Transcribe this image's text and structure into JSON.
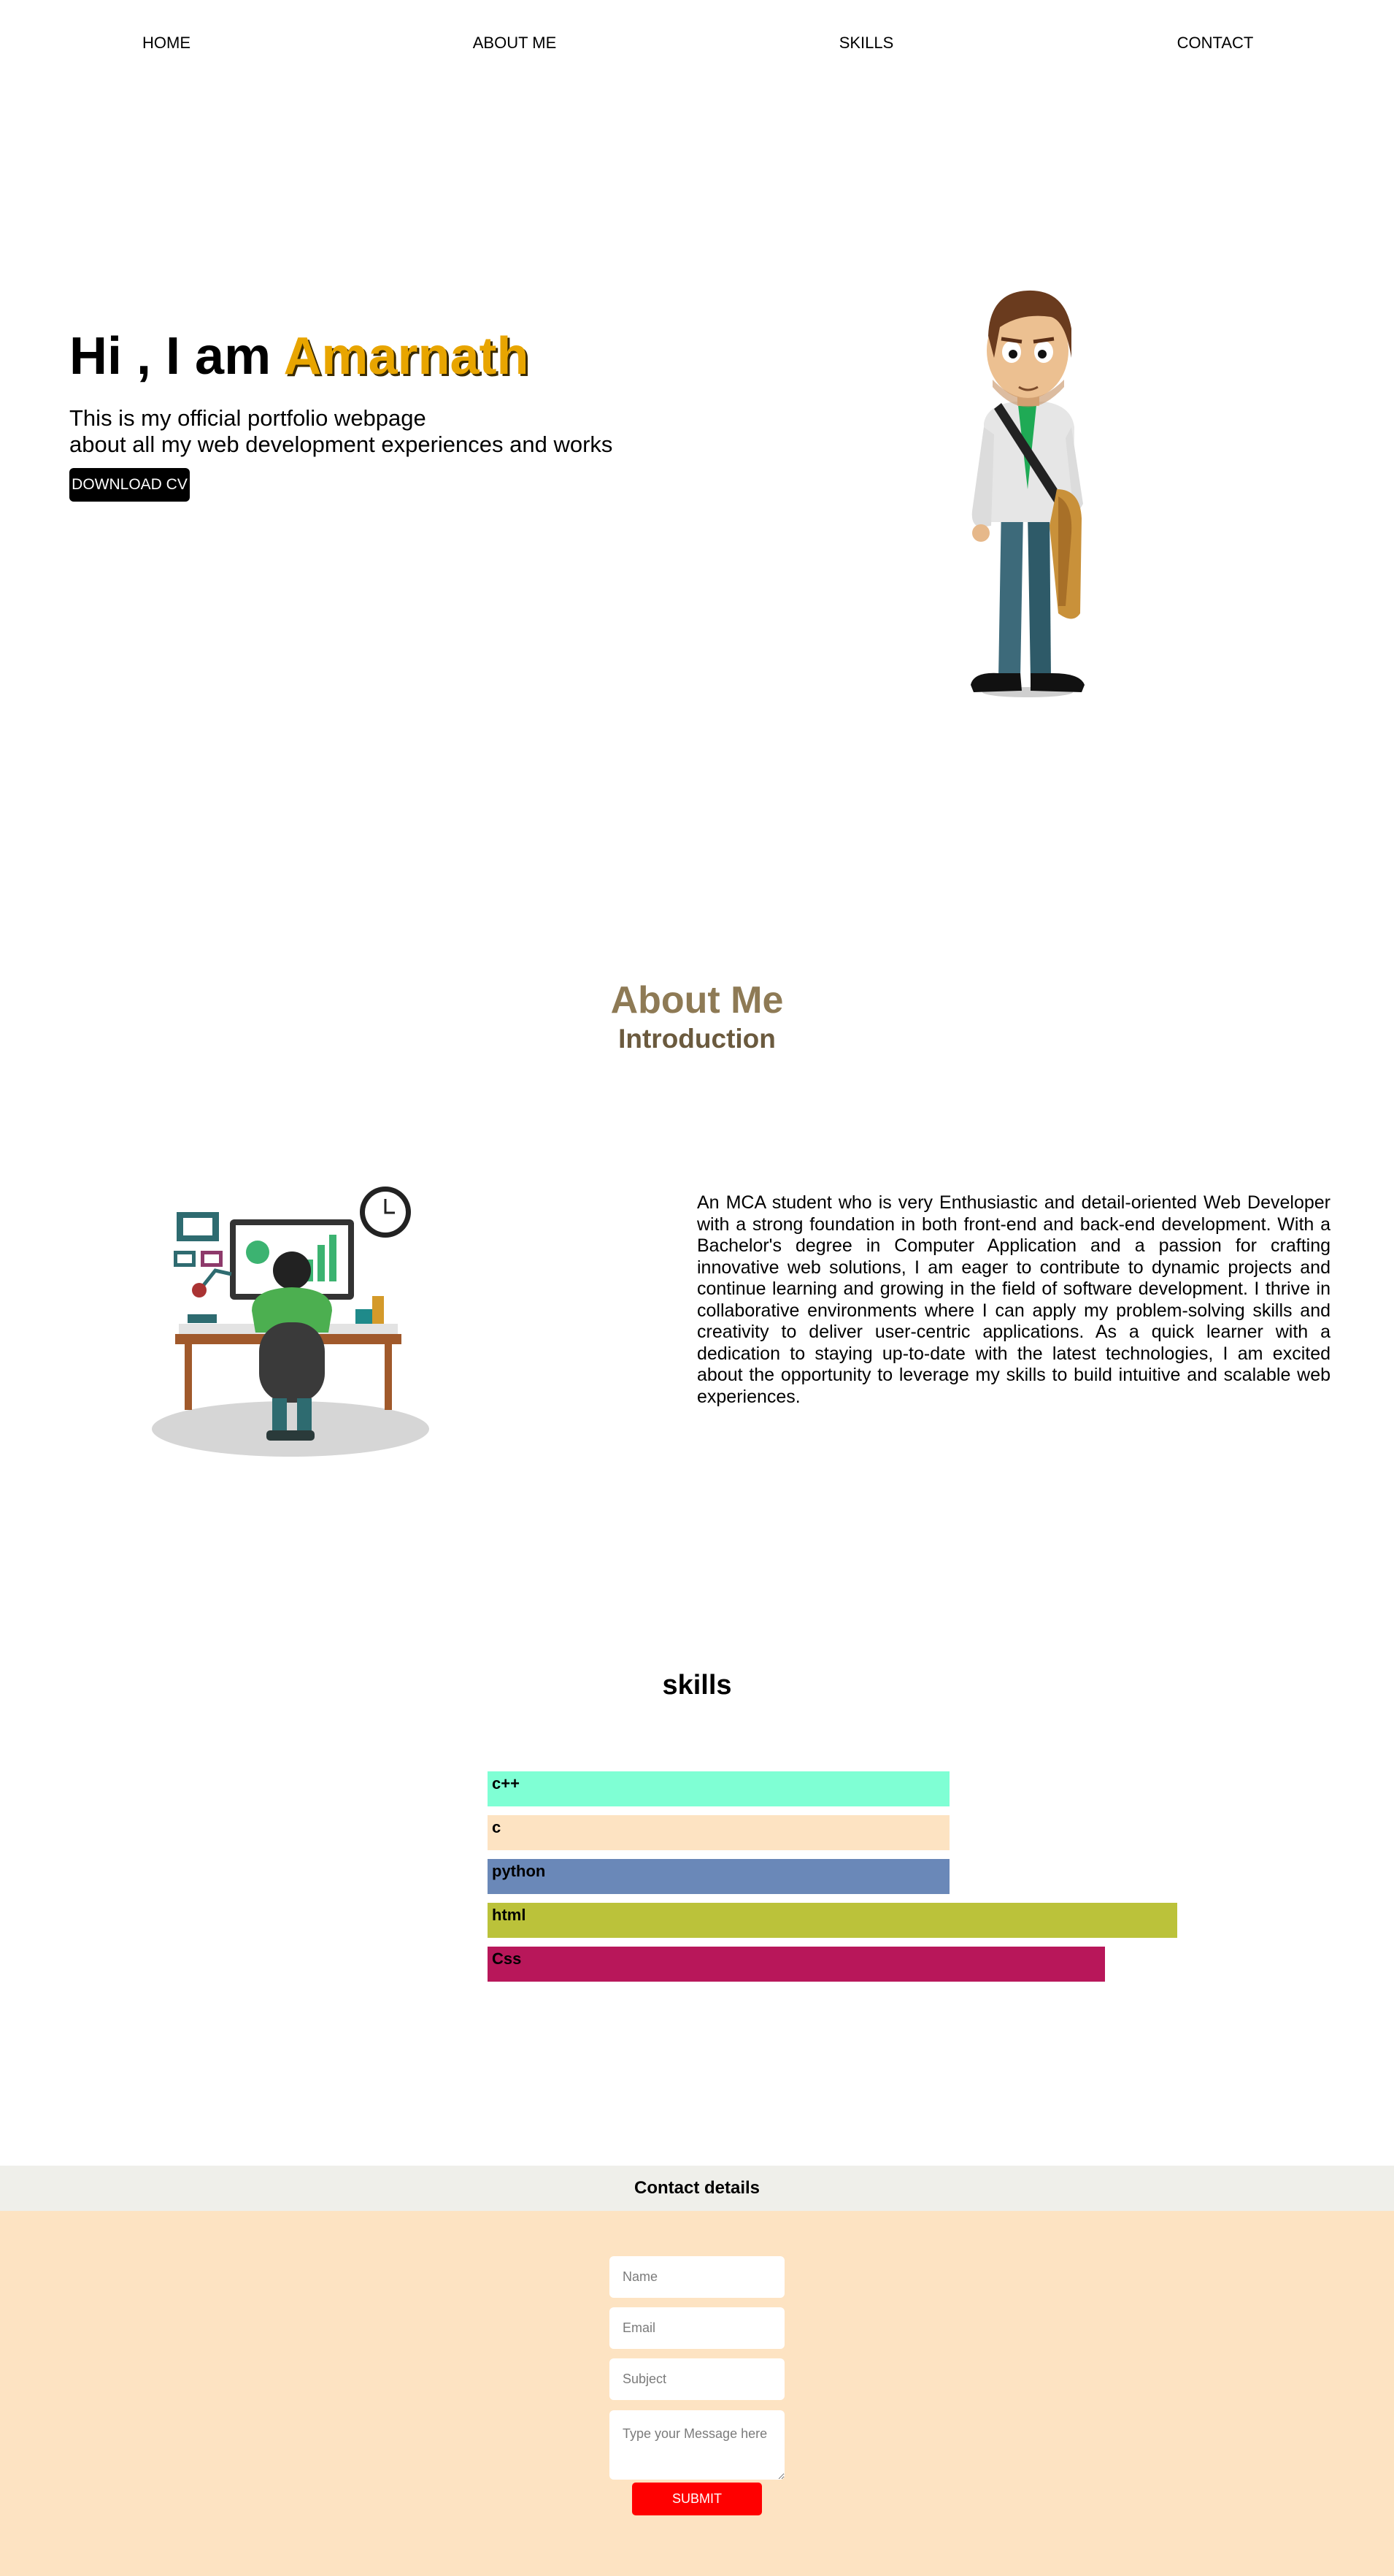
{
  "nav": {
    "items": [
      "HOME",
      "ABOUT ME",
      "SKILLS",
      "CONTACT"
    ]
  },
  "hero": {
    "greeting": "Hi , I am",
    "name": "Amarnath",
    "line1": "This is my official portfolio webpage",
    "line2": "about all my web development experiences and works",
    "cv_button": "DOWNLOAD CV",
    "name_color": "#e8a500"
  },
  "about": {
    "title": "About Me",
    "subtitle": "Introduction",
    "text": "An MCA student who is very Enthusiastic and detail-oriented Web Developer with a strong foundation in both front-end and back-end development. With a Bachelor's degree in Computer Application and a passion for crafting innovative web solutions, I am eager to contribute to dynamic projects and continue learning and growing in the field of software development. I thrive in collaborative environments where I can apply my problem-solving skills and creativity to deliver user-centric applications. As a quick learner with a dedication to staying up-to-date with the latest technologies, I am excited about the opportunity to leverage my skills to build intuitive and scalable web experiences.",
    "title_color": "#8e7a55"
  },
  "skills": {
    "title": "skills",
    "items": [
      {
        "label": "c++",
        "level": 0.67,
        "color": "#7fffd4"
      },
      {
        "label": "c",
        "level": 0.67,
        "color": "#fde3c2"
      },
      {
        "label": "python",
        "level": 0.67,
        "color": "#6a88b8"
      },
      {
        "label": "html",
        "level": 1.0,
        "color": "#bbc23a"
      },
      {
        "label": "Css",
        "level": 0.895,
        "color": "#b8175a"
      }
    ]
  },
  "contact": {
    "heading": "Contact details",
    "name_placeholder": "Name",
    "email_placeholder": "Email",
    "subject_placeholder": "Subject",
    "message_placeholder": "Type your Message here",
    "submit_label": "SUBMIT",
    "background_color": "#fde3c2",
    "submit_color": "#ff0000"
  }
}
